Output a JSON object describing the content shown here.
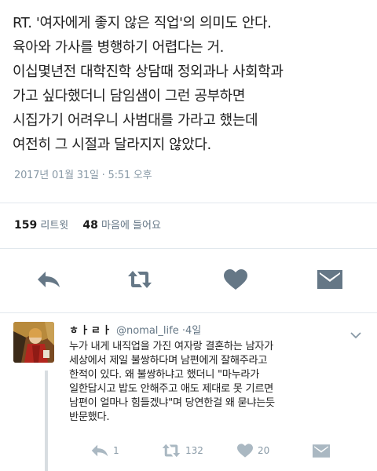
{
  "tweet": {
    "lines": [
      "RT. '여자에게 좋지 않은 직업'의 의미도 안다.",
      "육아와 가사를 병행하기 어렵다는 거.",
      "이십몇년전 대학진학 상담때 정외과나 사회학과",
      "가고 싶다했더니 담임샘이 그런 공부하면",
      "시집가기 어려우니 사범대를 가라고 했는데",
      "여전히 그 시절과 달라지지 않았다."
    ],
    "timestamp": "2017년 01월 31일 · 5:51 오후"
  },
  "stats": {
    "retweets_count": "159",
    "retweets_label": "리트윗",
    "likes_count": "48",
    "likes_label": "마음에 들어요"
  },
  "actions": {
    "reply_icon": "reply-icon",
    "retweet_icon": "retweet-icon",
    "like_icon": "heart-icon",
    "dm_icon": "envelope-icon"
  },
  "reply": {
    "display_name": "ㅎㅏㄹㅏ",
    "handle": "@nomal_life",
    "separator": "·",
    "age": "4일",
    "lines": [
      "누가 내게 내직업을 가진 여자랑 결혼하는 남자가",
      "세상에서 제일 불쌍하다며 남편에게 잘해주라고",
      "한적이 있다. 왜 불쌍하냐고 했더니 \"마누라가",
      "일한답시고 밥도 안해주고 애도 제대로 못 기르면",
      "남편이 얼마나 힘들겠냐\"며 당연한걸 왜 묻냐는듯",
      "반문했다."
    ],
    "reply_count": "1",
    "retweet_count": "132",
    "like_count": "20"
  },
  "colors": {
    "icon": "#657786",
    "muted": "#8899a6",
    "divider": "#e1e8ed"
  }
}
